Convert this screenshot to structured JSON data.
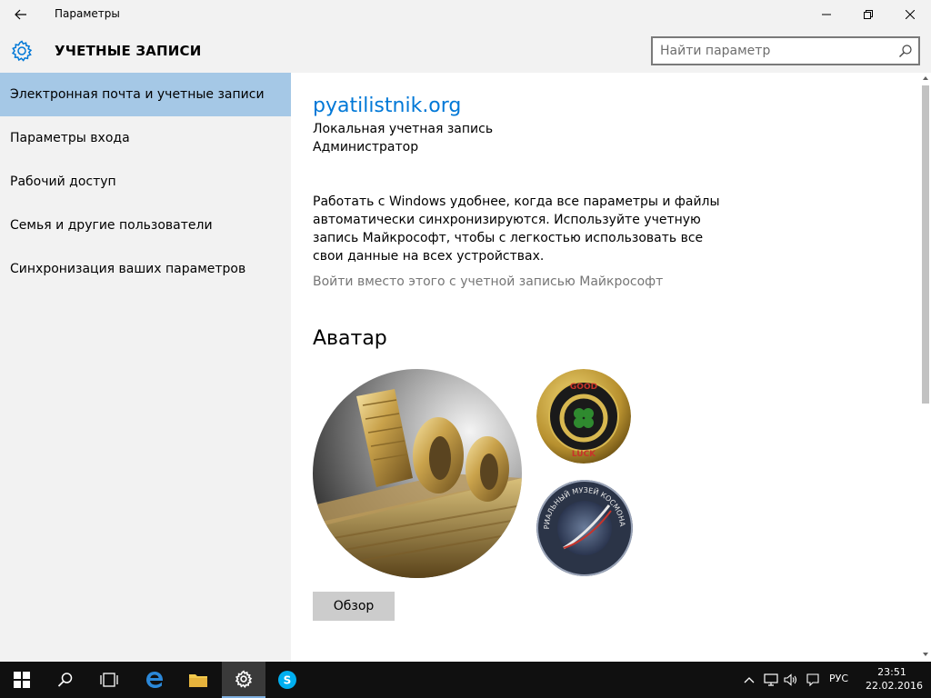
{
  "window": {
    "title": "Параметры"
  },
  "header": {
    "title": "УЧЕТНЫЕ ЗАПИСИ",
    "search_placeholder": "Найти параметр"
  },
  "sidebar": {
    "items": [
      {
        "label": "Электронная почта и учетные записи",
        "active": true
      },
      {
        "label": "Параметры входа",
        "active": false
      },
      {
        "label": "Рабочий доступ",
        "active": false
      },
      {
        "label": "Семья и другие пользователи",
        "active": false
      },
      {
        "label": "Синхронизация ваших параметров",
        "active": false
      }
    ]
  },
  "account": {
    "name": "pyatilistnik.org",
    "type": "Локальная учетная запись",
    "role": "Администратор",
    "sync_text": "Работать с Windows удобнее, когда все параметры и файлы автоматически синхронизируются. Используйте учетную запись Майкрософт, чтобы с легкостью использовать все свои данные на всех устройствах.",
    "ms_link": "Войти вместо этого с учетной записью Майкрософт"
  },
  "avatar": {
    "heading": "Аватар",
    "browse_label": "Обзор",
    "badge_top_text": "GOOD",
    "badge_bottom_text": "LUCK",
    "museum_text": "МЕМОРИАЛЬНЫЙ МУЗЕЙ КОСМОНАВТИКИ"
  },
  "taskbar": {
    "lang": "РУС",
    "time": "23:51",
    "date": "22.02.2016"
  },
  "colors": {
    "accent": "#0078d7",
    "selected_nav": "#a5c8e6",
    "taskbar": "#101010"
  }
}
